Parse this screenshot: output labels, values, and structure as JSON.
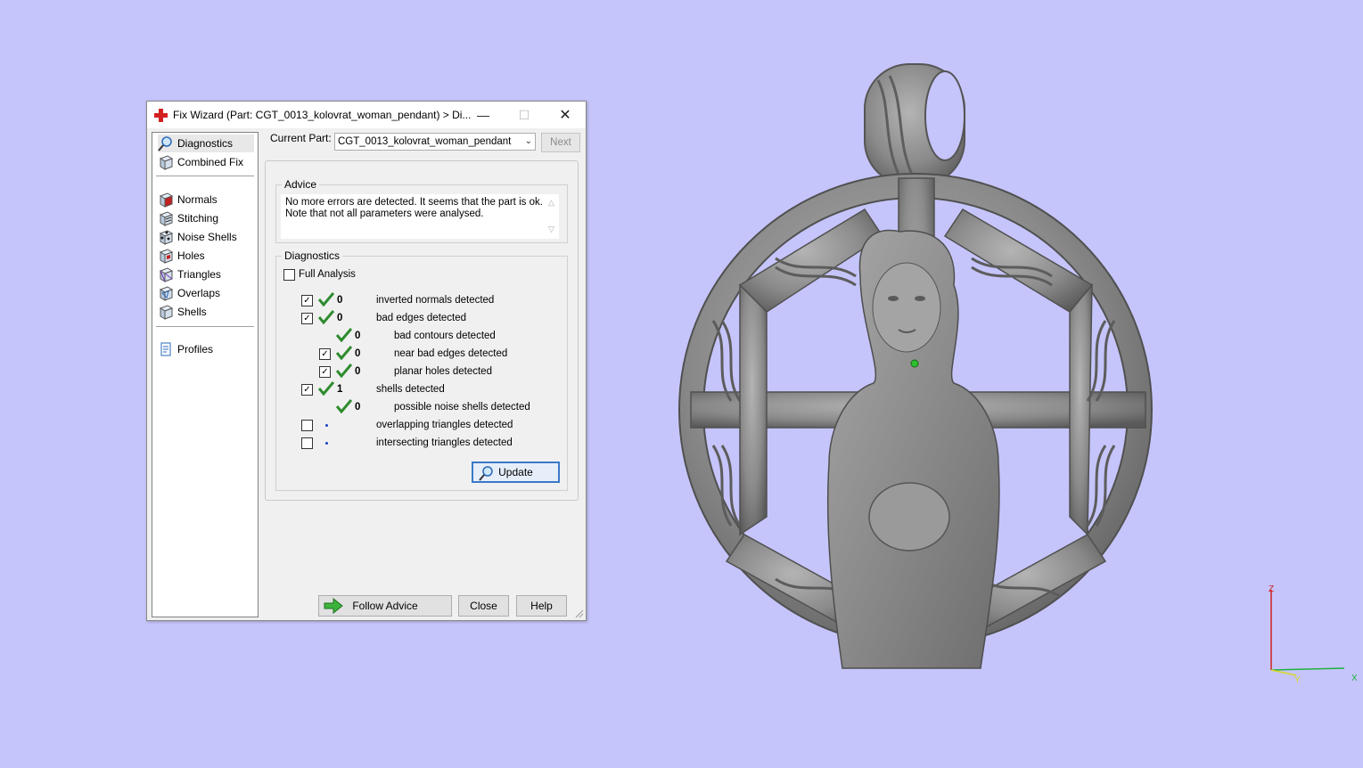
{
  "window": {
    "title": "Fix Wizard (Part: CGT_0013_kolovrat_woman_pendant) > Di...",
    "minimize_glyph": "—",
    "maximize_glyph": "☐",
    "close_glyph": "✕"
  },
  "sidebar": {
    "items": [
      {
        "label": "Diagnostics",
        "icon": "magnifier-icon",
        "selected": true
      },
      {
        "label": "Combined Fix",
        "icon": "cube-icon"
      },
      {
        "label": "Normals",
        "icon": "normals-cube-icon"
      },
      {
        "label": "Stitching",
        "icon": "stitching-cube-icon"
      },
      {
        "label": "Noise Shells",
        "icon": "noise-shells-icon"
      },
      {
        "label": "Holes",
        "icon": "holes-cube-icon"
      },
      {
        "label": "Triangles",
        "icon": "triangles-cube-icon"
      },
      {
        "label": "Overlaps",
        "icon": "overlaps-cube-icon"
      },
      {
        "label": "Shells",
        "icon": "shells-cube-icon"
      },
      {
        "label": "Profiles",
        "icon": "document-icon"
      }
    ]
  },
  "header": {
    "current_part_label": "Current Part:",
    "current_part_value": "CGT_0013_kolovrat_woman_pendant",
    "next_label": "Next"
  },
  "advice": {
    "title": "Advice",
    "line1": "No more errors are detected. It seems that the part is ok.",
    "line2": "Note that not all parameters were analysed."
  },
  "diagnostics": {
    "title": "Diagnostics",
    "full_analysis_label": "Full Analysis",
    "full_analysis_checked": false,
    "rows": [
      {
        "checked": true,
        "status": "ok",
        "count": "0",
        "label": "inverted normals detected"
      },
      {
        "checked": true,
        "status": "ok",
        "count": "0",
        "label": "bad edges detected"
      },
      {
        "checkbox": false,
        "status": "ok",
        "count": "0",
        "label": "bad contours detected",
        "indent": 1
      },
      {
        "checked": true,
        "status": "ok",
        "count": "0",
        "label": "near bad edges detected",
        "indent": 1
      },
      {
        "checked": true,
        "status": "ok",
        "count": "0",
        "label": "planar holes detected",
        "indent": 1
      },
      {
        "checked": true,
        "status": "ok",
        "count": "1",
        "label": "shells detected"
      },
      {
        "checkbox": false,
        "status": "ok",
        "count": "0",
        "label": "possible noise shells detected",
        "indent": 1
      },
      {
        "checked": false,
        "status": "not-run",
        "count": "",
        "label": "overlapping triangles detected"
      },
      {
        "checked": false,
        "status": "not-run",
        "count": "",
        "label": "intersecting triangles detected"
      }
    ],
    "update_label": "Update"
  },
  "footer": {
    "follow_advice_label": "Follow Advice",
    "close_label": "Close",
    "help_label": "Help"
  },
  "viewport": {
    "background_color": "#c5c5fb",
    "axis_z_label": "Z",
    "axis_y_label": "Y",
    "axis_x_label": "X",
    "model_color": "#8c8c8c"
  }
}
